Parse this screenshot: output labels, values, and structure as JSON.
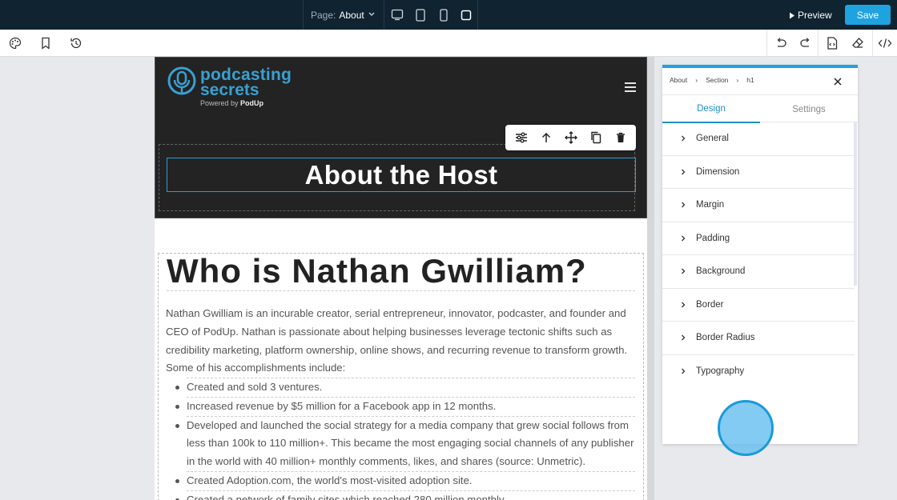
{
  "topbar": {
    "page_label": "Page:",
    "page_value": "About",
    "preview_label": "Preview",
    "save_label": "Save"
  },
  "canvas": {
    "logo": {
      "line1": "podcasting",
      "line2": "secrets",
      "powered": "Powered by",
      "brand": "PodUp"
    },
    "hero_heading": "About the Host",
    "who_heading": "Who is Nathan Gwilliam?",
    "paragraph": "Nathan Gwilliam is an incurable creator, serial entrepreneur, innovator, podcaster, and founder and CEO of PodUp. Nathan is passionate about helping businesses leverage tectonic shifts such as credibility marketing, platform ownership, online shows, and recurring revenue to transform growth. Some of his accomplishments include:",
    "list": [
      "Created and sold 3 ventures.",
      "Increased revenue by $5 million for a Facebook app in 12 months.",
      "Developed and launched the social strategy for a media company that grew social follows from less than 100k to 110 million+. This became the most engaging social channels of any publisher in the world with 40 million+ monthly comments, likes, and shares (source: Unmetric).",
      "Created Adoption.com, the world's most-visited adoption site.",
      "Created a network of family sites which reached 280 million monthly."
    ]
  },
  "panel": {
    "breadcrumb": [
      "About",
      "Section",
      "h1"
    ],
    "tabs": {
      "design": "Design",
      "settings": "Settings"
    },
    "sections": [
      "General",
      "Dimension",
      "Margin",
      "Padding",
      "Background",
      "Border",
      "Border Radius",
      "Typography"
    ]
  },
  "colors": {
    "topbar": "#0f2330",
    "accent": "#1ea3e0",
    "hero_bg": "#232323"
  }
}
